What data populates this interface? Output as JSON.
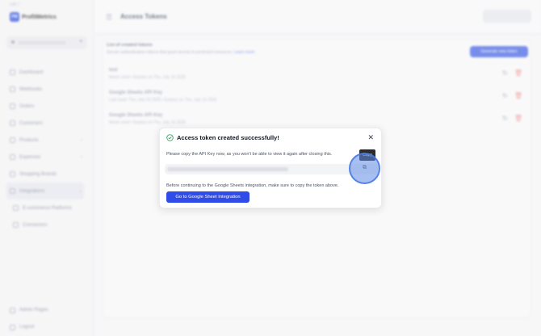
{
  "sidebar": {
    "build": "v48.7",
    "brand": "ProfitMetrics",
    "brand_mark": "PM",
    "items": [
      {
        "label": "Dashboard"
      },
      {
        "label": "Webhooks"
      },
      {
        "label": "Orders"
      },
      {
        "label": "Customers"
      },
      {
        "label": "Products"
      },
      {
        "label": "Expenses"
      },
      {
        "label": "Shopping Brands"
      },
      {
        "label": "Integrations"
      },
      {
        "label": "E-commerce Platforms"
      },
      {
        "label": "Connectors"
      }
    ],
    "bottom": [
      {
        "label": "Admin Pages"
      },
      {
        "label": "Logout"
      }
    ]
  },
  "topbar": {
    "title": "Access Tokens"
  },
  "panel": {
    "title": "List of created tokens",
    "subtitle": "Secure authentication tokens that grant access to protected resources.",
    "learn_more": "Learn more",
    "generate_label": "Generate new token",
    "tokens": [
      {
        "name": "test",
        "meta": "Never used • Expires on Thu, July 16 2026"
      },
      {
        "name": "Google Sheets API Key",
        "meta": "Last used: Thu, July 03 2025 • Expires on Thu, July 16 2026"
      },
      {
        "name": "Google Sheets API Key",
        "meta": "Never used • Expires on Thu, July 16 2026"
      }
    ]
  },
  "modal": {
    "title": "Access token created successfully!",
    "note": "Please copy the API Key now, as you won't be able to view it again after closing this.",
    "note2": "Before continuing to the Google Sheets integration, make sure to copy the token above.",
    "cta": "Go to Google Sheet Integration",
    "tooltip": "Copy",
    "close_glyph": "✕",
    "copy_glyph": "⧉"
  },
  "colors": {
    "accent": "#2f4be8",
    "success": "#16a34a",
    "danger": "#ef4444"
  }
}
